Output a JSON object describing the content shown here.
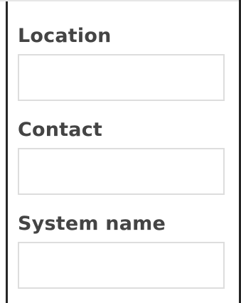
{
  "form": {
    "fields": [
      {
        "label": "Location",
        "value": "",
        "placeholder": ""
      },
      {
        "label": "Contact",
        "value": "",
        "placeholder": ""
      },
      {
        "label": "System name",
        "value": "",
        "placeholder": ""
      }
    ]
  },
  "colors": {
    "label_text": "#444444",
    "input_border": "#dddddd",
    "panel_border": "#262626",
    "background": "#ffffff"
  }
}
